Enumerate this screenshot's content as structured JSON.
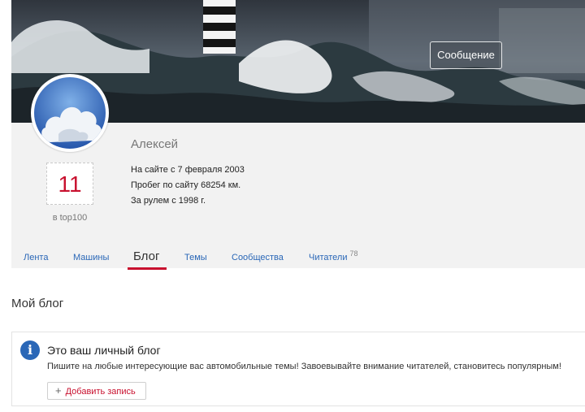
{
  "header": {
    "message_button": "Сообщение"
  },
  "profile": {
    "name": "Алексей",
    "rank": "11",
    "rank_label": "в top100",
    "stats": [
      {
        "prefix": "На сайте с ",
        "value": "7 февраля 2003"
      },
      {
        "prefix": "Пробег по сайту ",
        "value": "68254 км."
      },
      {
        "prefix": "За рулем с ",
        "value": "1998 г."
      }
    ]
  },
  "tabs": [
    {
      "label": "Лента"
    },
    {
      "label": "Машины"
    },
    {
      "label": "Блог",
      "active": true
    },
    {
      "label": "Темы"
    },
    {
      "label": "Сообщества"
    },
    {
      "label": "Читатели",
      "count": "78"
    }
  ],
  "blog": {
    "title": "Мой блог",
    "info_title": "Это ваш личный блог",
    "info_text": "Пишите на любые интересующие вас автомобильные темы! Завоевывайте внимание читателей, становитесь популярным!",
    "add_button": "Добавить запись"
  },
  "icons": {
    "info": "info-icon",
    "add": "plus-icon"
  },
  "colors": {
    "accent": "#c8102e",
    "link": "#2a67b7"
  }
}
